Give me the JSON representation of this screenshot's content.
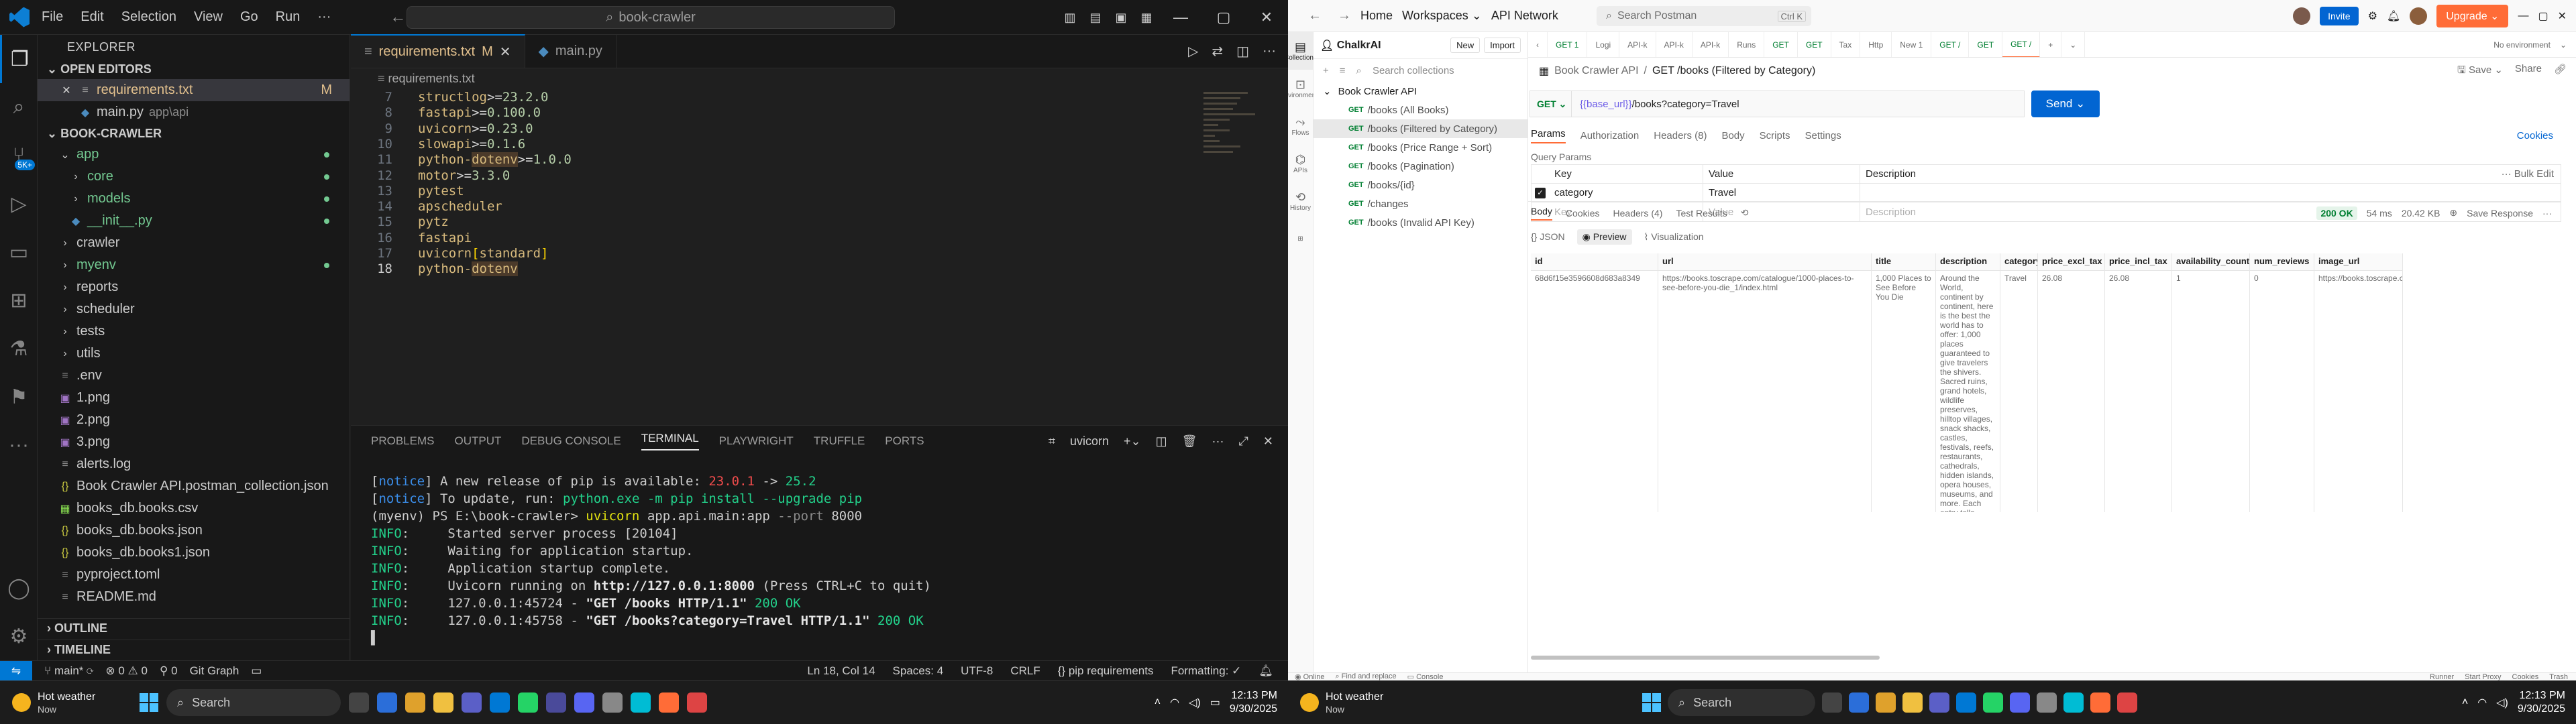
{
  "vscode": {
    "menu": [
      "File",
      "Edit",
      "Selection",
      "View",
      "Go",
      "Run",
      "···"
    ],
    "search": "book-crawler",
    "explorer_title": "EXPLORER",
    "open_editors_title": "OPEN EDITORS",
    "open_editors": [
      {
        "name": "requirements.txt",
        "badge": "M"
      },
      {
        "name": "main.py",
        "desc": "app\\api"
      }
    ],
    "project_title": "BOOK-CRAWLER",
    "tree": [
      {
        "name": "app",
        "type": "folder",
        "open": true
      },
      {
        "name": "core",
        "type": "folder"
      },
      {
        "name": "models",
        "type": "folder"
      },
      {
        "name": "__init__.py",
        "type": "py"
      },
      {
        "name": "crawler",
        "type": "folder"
      },
      {
        "name": "myenv",
        "type": "folder"
      },
      {
        "name": "reports",
        "type": "folder"
      },
      {
        "name": "scheduler",
        "type": "folder"
      },
      {
        "name": "tests",
        "type": "folder"
      },
      {
        "name": "utils",
        "type": "folder"
      },
      {
        "name": ".env",
        "type": "file"
      },
      {
        "name": "1.png",
        "type": "img"
      },
      {
        "name": "2.png",
        "type": "img"
      },
      {
        "name": "3.png",
        "type": "img"
      },
      {
        "name": "alerts.log",
        "type": "file"
      },
      {
        "name": "Book Crawler API.postman_collection.json",
        "type": "json"
      },
      {
        "name": "books_db.books.csv",
        "type": "csv"
      },
      {
        "name": "books_db.books.json",
        "type": "json"
      },
      {
        "name": "books_db.books1.json",
        "type": "json"
      },
      {
        "name": "pyproject.toml",
        "type": "file"
      },
      {
        "name": "README.md",
        "type": "file"
      }
    ],
    "outline_title": "OUTLINE",
    "timeline_title": "TIMELINE",
    "tabs": [
      {
        "label": "requirements.txt",
        "badge": "M"
      },
      {
        "label": "main.py"
      }
    ],
    "breadcrumb": "requirements.txt",
    "code_lines": [
      {
        "n": "7",
        "text": "structlog>=23.2.0"
      },
      {
        "n": "8",
        "text": "fastapi>=0.100.0"
      },
      {
        "n": "9",
        "text": "uvicorn>=0.23.0"
      },
      {
        "n": "10",
        "text": "slowapi>=0.1.6"
      },
      {
        "n": "11",
        "text": "python-dotenv>=1.0.0"
      },
      {
        "n": "12",
        "text": "motor>=3.3.0"
      },
      {
        "n": "13",
        "text": "pytest"
      },
      {
        "n": "14",
        "text": "apscheduler"
      },
      {
        "n": "15",
        "text": "pytz"
      },
      {
        "n": "16",
        "text": "fastapi"
      },
      {
        "n": "17",
        "text": "uvicorn[standard]"
      },
      {
        "n": "18",
        "text": "python-dotenv"
      }
    ],
    "panel_tabs": [
      "PROBLEMS",
      "OUTPUT",
      "DEBUG CONSOLE",
      "TERMINAL",
      "PLAYWRIGHT",
      "TRUFFLE",
      "PORTS"
    ],
    "terminal_name": "uvicorn",
    "terminal_lines": [
      "[notice] A new release of pip is available: 23.0.1 -> 25.2",
      "[notice] To update, run: python.exe -m pip install --upgrade pip",
      "(myenv) PS E:\\book-crawler> uvicorn app.api.main:app --port 8000",
      "INFO:     Started server process [20104]",
      "INFO:     Waiting for application startup.",
      "INFO:     Application startup complete.",
      "INFO:     Uvicorn running on http://127.0.0.1:8000 (Press CTRL+C to quit)",
      "INFO:     127.0.0.1:45724 - \"GET /books HTTP/1.1\" 200 OK",
      "INFO:     127.0.0.1:45758 - \"GET /books?category=Travel HTTP/1.1\" 200 OK"
    ],
    "status": {
      "branch": "main*",
      "errors": "0",
      "warnings": "0",
      "git_graph": "Git Graph",
      "position": "Ln 18, Col 14",
      "spaces": "Spaces: 4",
      "encoding": "UTF-8",
      "eol": "CRLF",
      "language": "pip requirements",
      "formatting": "Formatting: ✓"
    }
  },
  "postman": {
    "nav": [
      "Home",
      "Workspaces",
      "API Network"
    ],
    "search": "Search Postman",
    "search_kbd": "Ctrl K",
    "invite": "Invite",
    "upgrade": "Upgrade",
    "workspace": "ChalkrAI",
    "new_btn": "New",
    "import_btn": "Import",
    "rail": [
      "Collections",
      "Environments",
      "Flows",
      "APIs",
      "History"
    ],
    "side_search": "Search collections",
    "collection": "Book Crawler API",
    "requests": [
      "/books (All Books)",
      "/books (Filtered by Category)",
      "/books (Price Range + Sort)",
      "/books (Pagination)",
      "/books/{id}",
      "/changes",
      "/books (Invalid API Key)"
    ],
    "method": "GET",
    "tabs": [
      "GET 1",
      "Logi",
      "API-k",
      "API-k",
      "API-k",
      "Runs",
      "GET",
      "GET",
      "Tax",
      "Http",
      "New 1",
      "GET /",
      "GET",
      "GET /"
    ],
    "env": "No environment",
    "req_collection": "Book Crawler API",
    "req_title": "GET /books (Filtered by Category)",
    "save": "Save",
    "share": "Share",
    "url_var": "{{base_url}}",
    "url_path": "/books?category=Travel",
    "send": "Send",
    "req_tabs": [
      "Params",
      "Authorization",
      "Headers (8)",
      "Body",
      "Scripts",
      "Settings"
    ],
    "cookies": "Cookies",
    "qp_title": "Query Params",
    "qp_headers": [
      "Key",
      "Value",
      "Description"
    ],
    "bulk_edit": "Bulk Edit",
    "qp_rows": [
      {
        "key": "category",
        "value": "Travel"
      }
    ],
    "qp_placeholders": [
      "Key",
      "Value",
      "Description"
    ],
    "res_tabs": [
      "Body",
      "Cookies",
      "Headers (4)",
      "Test Results"
    ],
    "res_status": "200 OK",
    "res_time": "54 ms",
    "res_size": "20.42 KB",
    "save_response": "Save Response",
    "res_formats": [
      "JSON",
      "Preview",
      "Visualization"
    ],
    "columns": [
      "id",
      "url",
      "title",
      "description",
      "category",
      "price_excl_tax",
      "price_incl_tax",
      "availability_count",
      "num_reviews",
      "image_url"
    ],
    "row": {
      "id": "68d6f15e3596608d683a8349",
      "url": "https://books.toscrape.com/catalogue/1000-places-to-see-before-you-die_1/index.html",
      "title": "1,000 Places to See Before You Die",
      "description": "Around the World, continent by continent, here is the best the world has to offer: 1,000 places guaranteed to give travelers the shivers. Sacred ruins, grand hotels, wildlife preserves, hilltop villages, snack shacks, castles, festivals, reefs, restaurants, cathedrals, hidden islands, opera houses, museums, and more. Each entry tells exactly why it's essential to visit. Th Around the World, continent by continent, here is",
      "category": "Travel",
      "price_excl_tax": "26.08",
      "price_incl_tax": "26.08",
      "availability_count": "1",
      "num_reviews": "0",
      "image_url": "https://books.toscrape.com/media/c"
    },
    "status_left": [
      "Online",
      "Find and replace",
      "Console"
    ],
    "status_right": [
      "Runner",
      "Start Proxy",
      "Cookies",
      "Trash"
    ]
  },
  "taskbar": {
    "weather_title": "Hot weather",
    "weather_sub": "Now",
    "search": "Search",
    "time": "12:13 PM",
    "date": "9/30/2025"
  },
  "colors": {
    "vs_accent": "#0078d4",
    "pm_orange": "#ff6c37",
    "pm_blue": "#0265d2",
    "get_green": "#007f31"
  }
}
